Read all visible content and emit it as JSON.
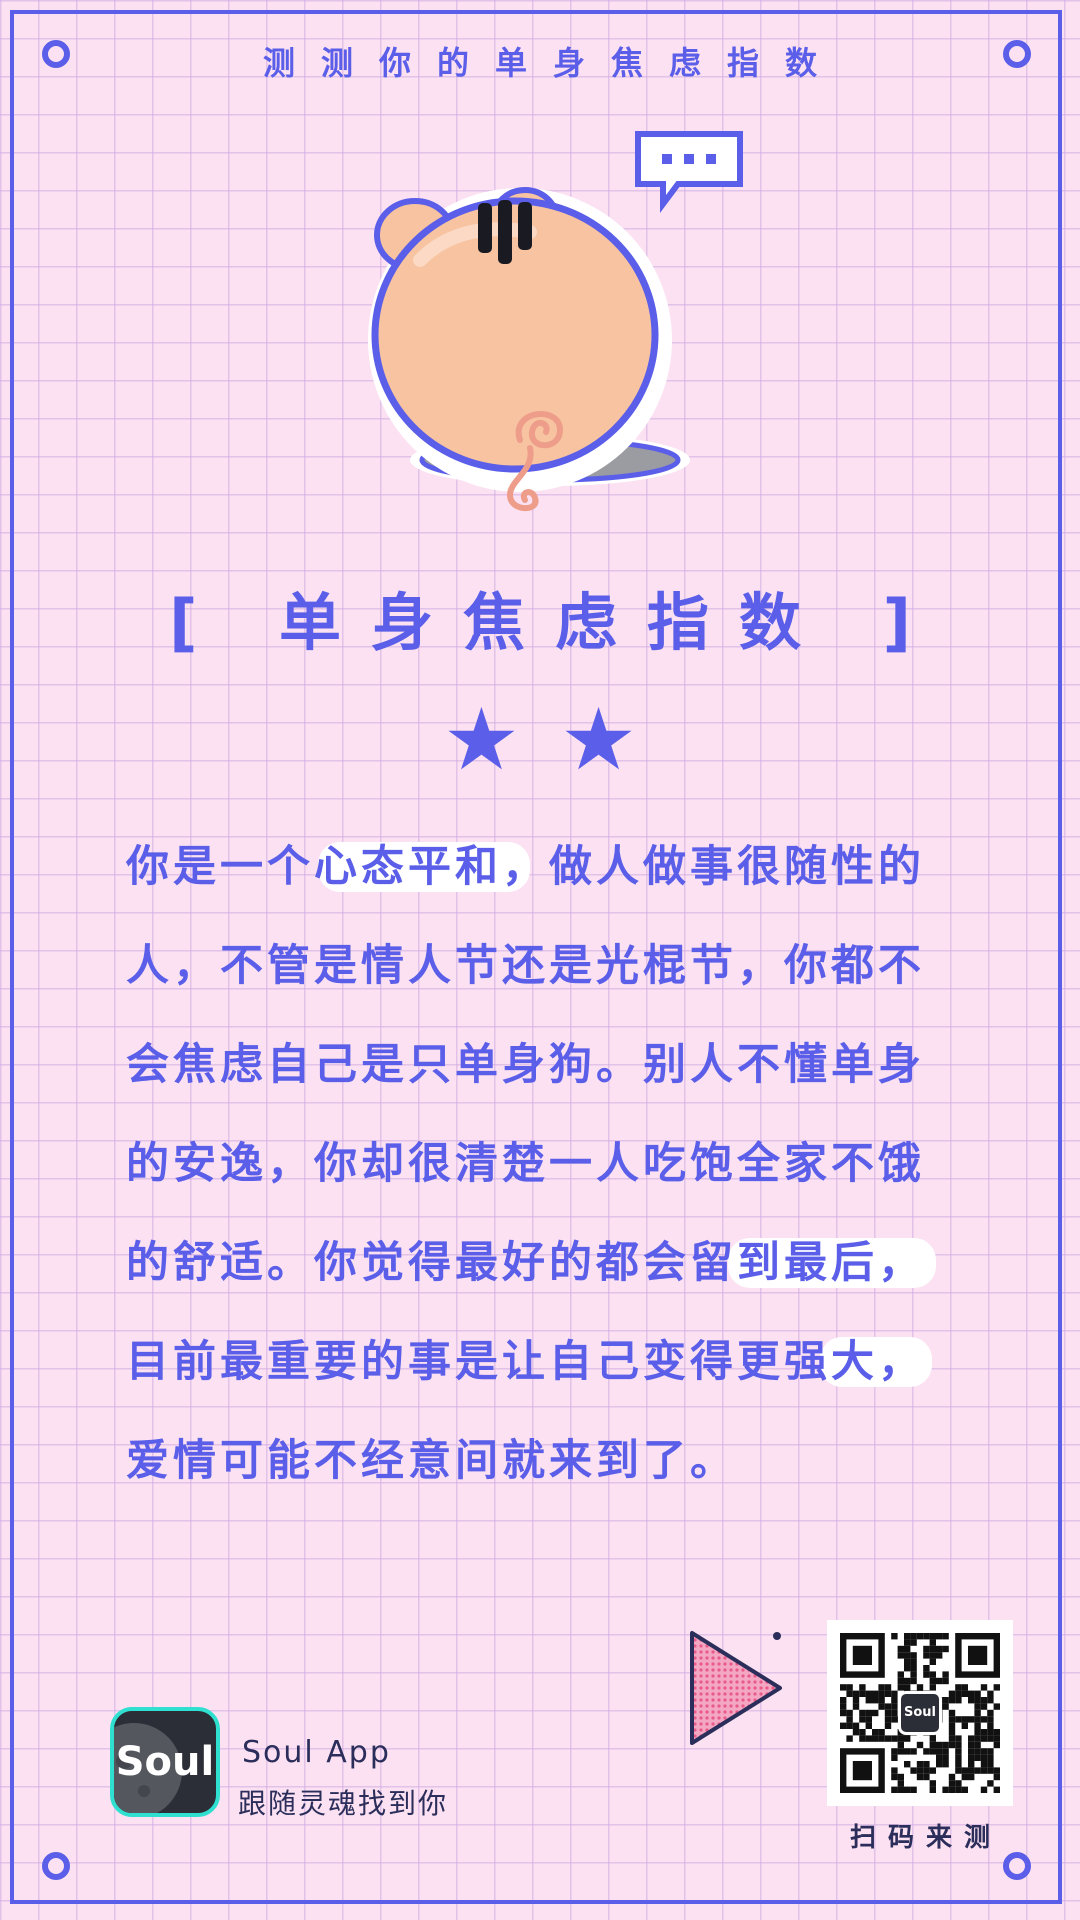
{
  "header": {
    "title": "测测你的单身焦虑指数"
  },
  "result": {
    "heading": "[ 单身焦虑指数 ]",
    "stars": "★★",
    "star_count": 2,
    "lines": [
      "你是一个心态平和，做人做事很随性的",
      "人，不管是情人节还是光棍节，你都不",
      "会焦虑自己是只单身狗。别人不懂单身",
      "的安逸，你却很清楚一人吃饱全家不饿",
      "的舒适。你觉得最好的都会留到最后，",
      "目前最重要的事是让自己变得更强大，",
      "爱情可能不经意间就来到了。"
    ]
  },
  "footer": {
    "logo_text": "Soul",
    "app_name": "Soul App",
    "slogan": "跟随灵魂找到你",
    "qr_logo_text": "Soul",
    "qr_label": "扫码来测"
  },
  "colors": {
    "accent": "#5a5ee8",
    "background": "#fbe1f1",
    "grid": "#cdaae1",
    "pig_body": "#f7c3a0",
    "logo_border": "#2fe0d0",
    "triangle": "#e75a8a"
  },
  "icons": {
    "mascot": "pig-back-illustration",
    "speech": "speech-bubble-icon",
    "play": "play-triangle-icon"
  }
}
